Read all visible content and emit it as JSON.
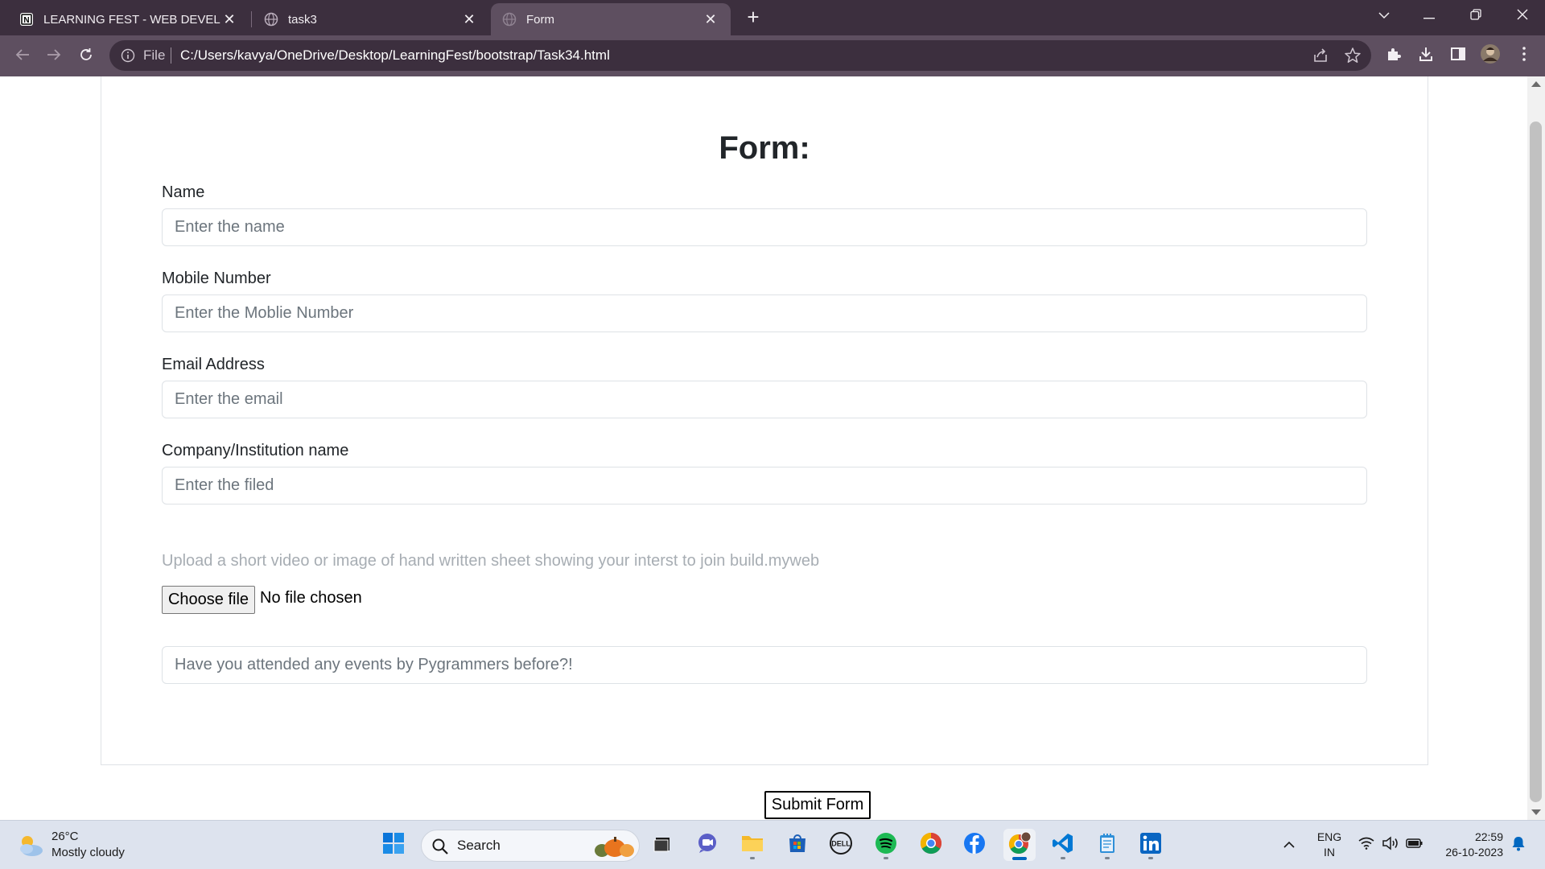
{
  "browser": {
    "tabs": [
      {
        "title": "LEARNING FEST - WEB DEVELOP",
        "icon": "notion-icon",
        "active": false
      },
      {
        "title": "task3",
        "icon": "globe-icon",
        "active": false
      },
      {
        "title": "Form",
        "icon": "globe-icon",
        "active": true
      }
    ],
    "address": {
      "scheme": "File",
      "url": "C:/Users/kavya/OneDrive/Desktop/LearningFest/bootstrap/Task34.html"
    }
  },
  "page": {
    "title": "Form:",
    "fields": [
      {
        "label": "Name",
        "placeholder": "Enter the name"
      },
      {
        "label": "Mobile Number",
        "placeholder": "Enter the Moblie Number"
      },
      {
        "label": "Email Address",
        "placeholder": "Enter the email"
      },
      {
        "label": "Company/Institution name",
        "placeholder": "Enter the filed"
      }
    ],
    "upload_text": "Upload a short video or image of hand written sheet showing your interst to join build.myweb",
    "file_button": "Choose file",
    "file_status": "No file chosen",
    "events_placeholder": "Have you attended any events by Pygrammers before?!",
    "submit_label": "Submit Form"
  },
  "taskbar": {
    "weather": {
      "temp": "26°C",
      "desc": "Mostly cloudy"
    },
    "search_label": "Search",
    "apps": [
      "windows-start-icon",
      "file-explorer-icon",
      "teams-chat-icon",
      "folder-icon",
      "microsoft-store-icon",
      "dell-icon",
      "spotify-icon",
      "chrome-icon",
      "facebook-icon",
      "chrome-profile-icon",
      "vscode-icon",
      "notepad-icon",
      "linkedin-icon"
    ],
    "lang_line1": "ENG",
    "lang_line2": "IN",
    "time": "22:59",
    "date": "26-10-2023"
  },
  "colors": {
    "titlebar": "#3c2f3e",
    "toolbar": "#5e4f60",
    "accent": "#0067c0"
  }
}
